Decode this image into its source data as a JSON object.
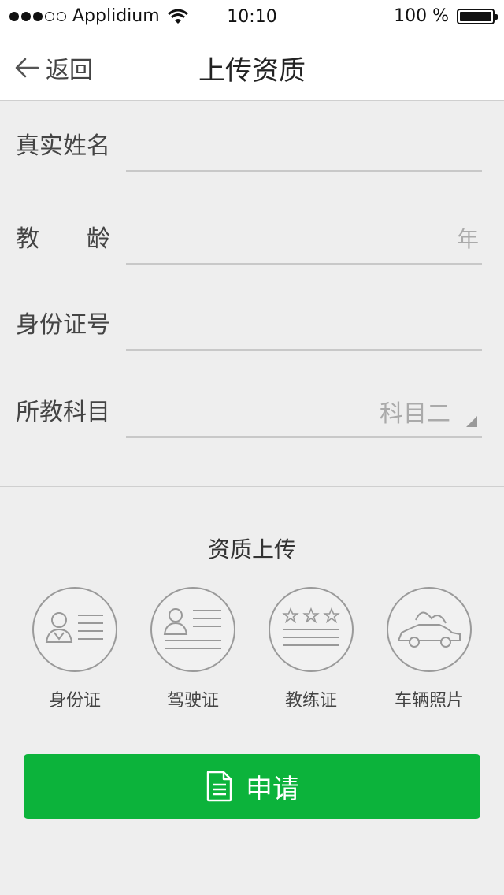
{
  "status_bar": {
    "carrier": "Applidium",
    "time": "10:10",
    "battery_text": "100 %",
    "battery_level": 1.0
  },
  "nav": {
    "back_label": "返回",
    "title": "上传资质"
  },
  "form": {
    "real_name": {
      "label": "真实姓名",
      "value": ""
    },
    "teaching_years": {
      "label": "教　　龄",
      "value": "",
      "suffix": "年"
    },
    "id_number": {
      "label": "身份证号",
      "value": ""
    },
    "subject": {
      "label": "所教科目",
      "selected": "科目二"
    }
  },
  "uploads": {
    "title": "资质上传",
    "items": [
      {
        "label": "身份证",
        "icon": "id-card-icon"
      },
      {
        "label": "驾驶证",
        "icon": "driver-license-icon"
      },
      {
        "label": "教练证",
        "icon": "coach-certificate-icon"
      },
      {
        "label": "车辆照片",
        "icon": "car-photo-icon"
      }
    ]
  },
  "apply_button": {
    "label": "申请",
    "color": "#0cb33b"
  }
}
